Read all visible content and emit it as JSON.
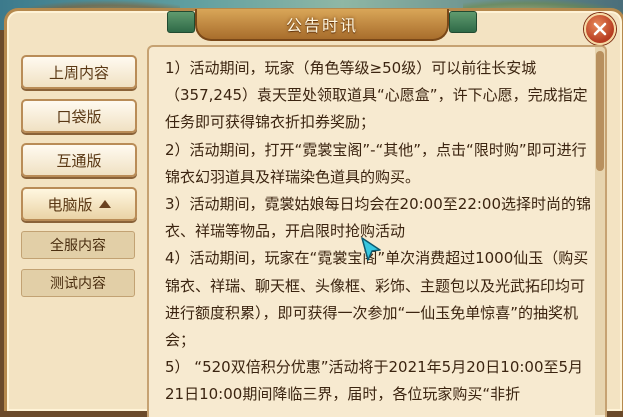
{
  "window": {
    "title": "公告时讯"
  },
  "sidebar": {
    "items": [
      {
        "label": "上周内容"
      },
      {
        "label": "口袋版"
      },
      {
        "label": "互通版"
      },
      {
        "label": "电脑版"
      }
    ],
    "sub_items": [
      {
        "label": "全服内容"
      },
      {
        "label": "测试内容"
      }
    ]
  },
  "content": {
    "paragraphs": [
      "1）活动期间，玩家（角色等级≥50级）可以前往长安城（357,245）袁天罡处领取道具“心愿盒”，许下心愿，完成指定任务即可获得锦衣折扣券奖励；",
      "2）活动期间，打开“霓裳宝阁”-“其他”，点击“限时购”即可进行锦衣幻羽道具及祥瑞染色道具的购买。",
      "3）活动期间，霓裳姑娘每日均会在20:00至22:00选择时尚的锦衣、祥瑞等物品，开启限时抢购活动",
      "4）活动期间，玩家在“霓裳宝阁”单次消费超过1000仙玉（购买锦衣、祥瑞、聊天框、头像框、彩饰、主题包以及光武拓印均可进行额度积累），即可获得一次参加“一仙玉免单惊喜”的抽奖机会；",
      "5） “520双倍积分优惠”活动将于2021年5月20日10:00至5月21日10:00期间降临三界，届时，各位玩家购买“非折"
    ]
  },
  "colors": {
    "accent": "#b5894d",
    "panel": "#f7ead0",
    "close": "#b63b20"
  }
}
